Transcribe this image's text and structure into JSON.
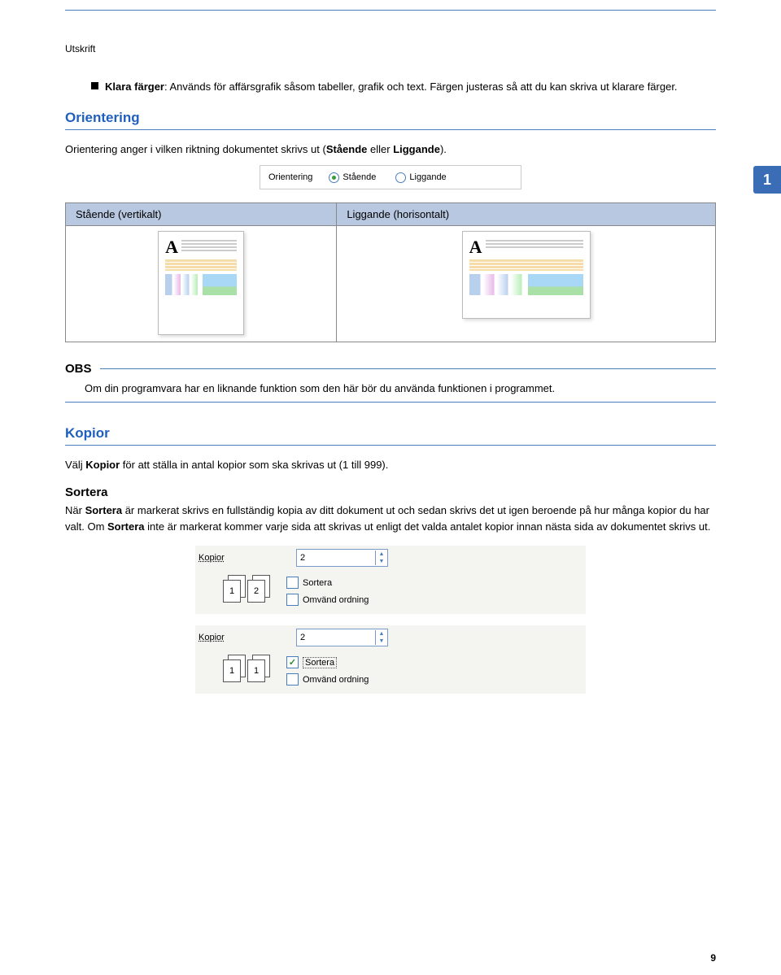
{
  "header": "Utskrift",
  "side_badge": "1",
  "bullet": {
    "bold": "Klara färger",
    "rest": ": Används för affärsgrafik såsom tabeller, grafik och text. Färgen justeras så att du kan skriva ut klarare färger."
  },
  "sect1": {
    "title": "Orientering",
    "para_pre": "Orientering anger i vilken riktning dokumentet skrivs ut (",
    "b1": "Stående",
    "mid": " eller ",
    "b2": "Liggande",
    "post": ")."
  },
  "orient_ui": {
    "label": "Orientering",
    "opt1": "Stående",
    "opt2": "Liggande"
  },
  "table": {
    "h1": "Stående (vertikalt)",
    "h2": "Liggande (horisontalt)"
  },
  "obs": {
    "title": "OBS",
    "body": "Om din programvara har en liknande funktion som den här bör du använda funktionen i programmet."
  },
  "sect2": {
    "title": "Kopior",
    "para_pre": "Välj ",
    "b": "Kopior",
    "rest": " för att ställa in antal kopior som ska skrivas ut (1 till 999)."
  },
  "sortera": {
    "title": "Sortera",
    "p_pre": "När ",
    "b1": "Sortera",
    "p_mid": " är markerat skrivs en fullständig kopia av ditt dokument ut och sedan skrivs det ut igen beroende på hur många kopior du har valt. Om ",
    "b2": "Sortera",
    "p_end": " inte är markerat kommer varje sida att skrivas ut enligt det valda antalet kopior innan nästa sida av dokumentet skrivs ut."
  },
  "panel": {
    "kopior_label": "Kopior",
    "value": "2",
    "sort": "Sortera",
    "rev": "Omvänd ordning"
  },
  "page_num": "9"
}
